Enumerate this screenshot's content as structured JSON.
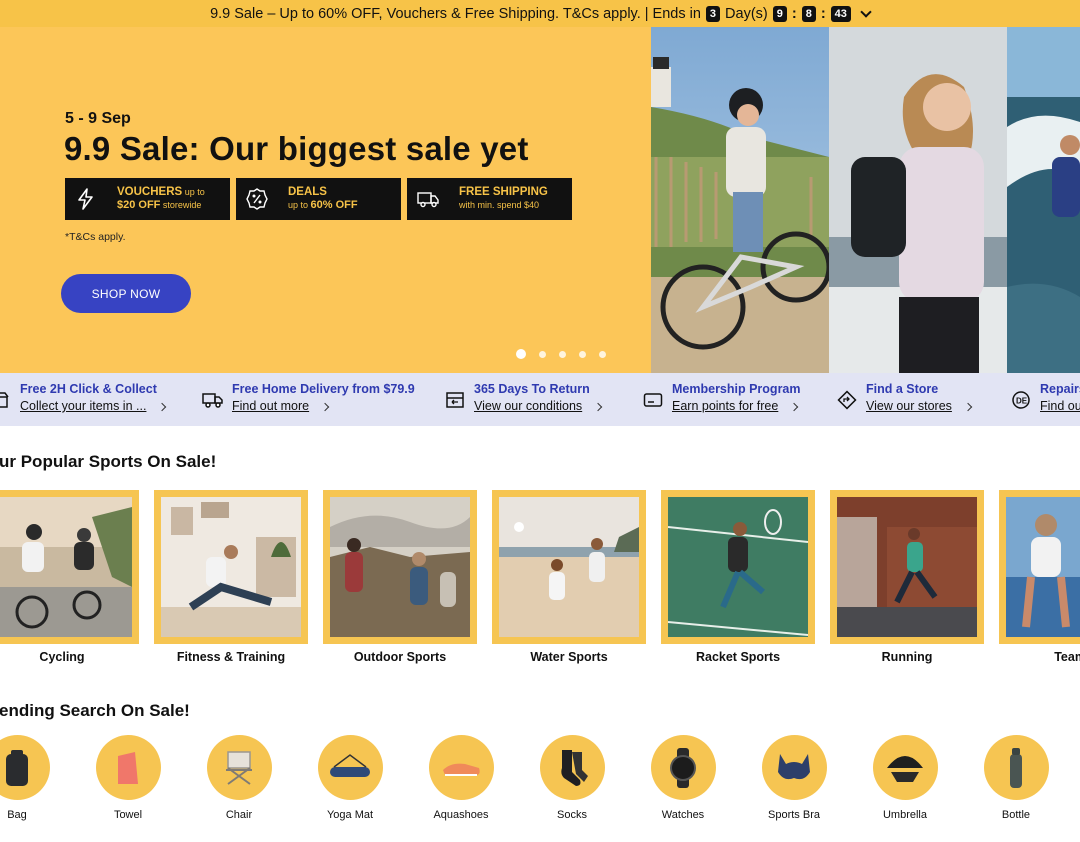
{
  "promo": {
    "text": "9.9 Sale – Up to 60% OFF, Vouchers & Free Shipping. T&Cs apply.",
    "sep": "|",
    "ends_in": "Ends in",
    "days": "3",
    "days_label": "Day(s)",
    "hours": "9",
    "minutes": "8",
    "seconds": "43",
    "colon": ":"
  },
  "hero": {
    "date": "5 - 9 Sep",
    "title": "9.9 Sale: Our biggest sale yet",
    "perks": [
      {
        "l1": "VOUCHERS",
        "l1_small": " up to",
        "l2": "$20 OFF",
        "l2_small": " storewide",
        "icon": "lightning-icon"
      },
      {
        "l1": "DEALS",
        "l1_small": "",
        "l2_small": "up to ",
        "l2": "60% OFF",
        "icon": "percent-badge-icon"
      },
      {
        "l1": "FREE SHIPPING",
        "l1_small": "",
        "l2_small": "with min. spend $40",
        "l2": "",
        "icon": "truck-icon"
      }
    ],
    "tc": "*T&Cs apply.",
    "cta": "SHOP NOW",
    "slide_count": 5,
    "active_slide": 1
  },
  "services": [
    {
      "title": "Free 2H Click & Collect",
      "link": "Collect your items in ...",
      "icon": "store-icon"
    },
    {
      "title": "Free Home Delivery from $79.9",
      "link": "Find out more",
      "icon": "truck-icon"
    },
    {
      "title": "365 Days To Return",
      "link": "View our conditions",
      "icon": "return-box-icon"
    },
    {
      "title": "Membership Program",
      "link": "Earn points for free",
      "icon": "membership-card-icon"
    },
    {
      "title": "Find a Store",
      "link": "View our stores",
      "icon": "direction-sign-icon"
    },
    {
      "title": "Repairs",
      "link": "Find ou",
      "icon": "repair-badge-icon"
    }
  ],
  "sports_section": {
    "title": "ur Popular Sports On Sale!",
    "items": [
      "Cycling",
      "Fitness & Training",
      "Outdoor Sports",
      "Water Sports",
      "Racket Sports",
      "Running",
      "Team S"
    ]
  },
  "trending_section": {
    "title": "ending Search On Sale!",
    "items": [
      "Bag",
      "Towel",
      "Chair",
      "Yoga Mat",
      "Aquashoes",
      "Socks",
      "Watches",
      "Sports Bra",
      "Umbrella",
      "Bottle"
    ]
  },
  "colors": {
    "accent_yellow": "#fcc658",
    "brand_blue": "#3743c3",
    "service_bg": "#e2e4f4",
    "link_blue": "#2f3ab0"
  }
}
